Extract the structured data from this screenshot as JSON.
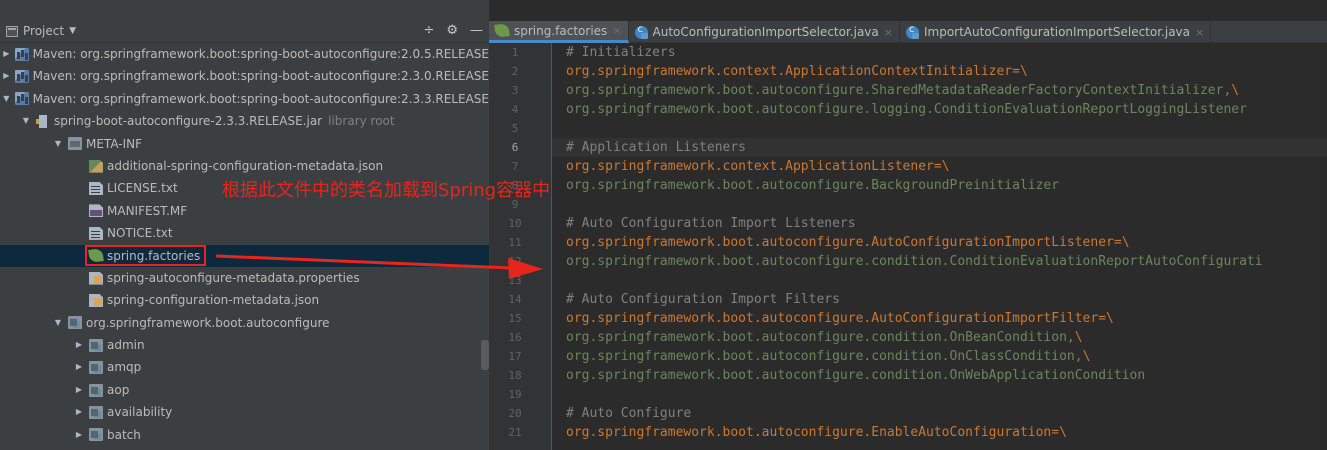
{
  "project": {
    "title": "Project",
    "tools": [
      "÷",
      "⚙",
      "—"
    ],
    "tree": [
      {
        "level": 0,
        "toggle": "collapsed",
        "icon": "maven-library-icon",
        "label": "Maven: org.springframework.boot:spring-boot-autoconfigure:2.0.5.RELEASE"
      },
      {
        "level": 0,
        "toggle": "collapsed",
        "icon": "maven-library-icon",
        "label": "Maven: org.springframework.boot:spring-boot-autoconfigure:2.3.0.RELEASE"
      },
      {
        "level": 0,
        "toggle": "expanded",
        "icon": "maven-library-icon",
        "label": "Maven: org.springframework.boot:spring-boot-autoconfigure:2.3.3.RELEASE"
      },
      {
        "level": 1,
        "toggle": "expanded",
        "icon": "jar-icon",
        "label": "spring-boot-autoconfigure-2.3.3.RELEASE.jar",
        "suffix": "library root"
      },
      {
        "level": 2,
        "toggle": "expanded",
        "icon": "folder-icon",
        "label": "META-INF"
      },
      {
        "level": 3,
        "toggle": "none",
        "icon": "json-icon",
        "label": "additional-spring-configuration-metadata.json"
      },
      {
        "level": 3,
        "toggle": "none",
        "icon": "text-file-icon",
        "label": "LICENSE.txt"
      },
      {
        "level": 3,
        "toggle": "none",
        "icon": "manifest-icon",
        "label": "MANIFEST.MF"
      },
      {
        "level": 3,
        "toggle": "none",
        "icon": "text-file-icon",
        "label": "NOTICE.txt"
      },
      {
        "level": 3,
        "toggle": "none",
        "icon": "spring-icon",
        "label": "spring.factories",
        "selected": true
      },
      {
        "level": 3,
        "toggle": "none",
        "icon": "properties-icon",
        "label": "spring-autoconfigure-metadata.properties"
      },
      {
        "level": 3,
        "toggle": "none",
        "icon": "json-config-icon",
        "label": "spring-configuration-metadata.json"
      },
      {
        "level": 2,
        "toggle": "expanded",
        "icon": "package-icon",
        "label": "org.springframework.boot.autoconfigure"
      },
      {
        "level": 3,
        "toggle": "collapsed",
        "icon": "package-icon",
        "label": "admin"
      },
      {
        "level": 3,
        "toggle": "collapsed",
        "icon": "package-icon",
        "label": "amqp"
      },
      {
        "level": 3,
        "toggle": "collapsed",
        "icon": "package-icon",
        "label": "aop"
      },
      {
        "level": 3,
        "toggle": "collapsed",
        "icon": "package-icon",
        "label": "availability"
      },
      {
        "level": 3,
        "toggle": "collapsed",
        "icon": "package-icon",
        "label": "batch"
      }
    ]
  },
  "editor": {
    "tabs": [
      {
        "label": "spring.factories",
        "icon": "spring-icon",
        "active": true
      },
      {
        "label": "AutoConfigurationImportSelector.java",
        "icon": "class-icon",
        "active": false
      },
      {
        "label": "ImportAutoConfigurationImportSelector.java",
        "icon": "class-icon",
        "active": false
      }
    ],
    "current_line": 6,
    "lines": [
      {
        "n": "1",
        "type": "comment",
        "text": "# Initializers"
      },
      {
        "n": "2",
        "type": "key",
        "text": "org.springframework.context.ApplicationContextInitializer",
        "op": "=\\"
      },
      {
        "n": "3",
        "type": "value",
        "text": "org.springframework.boot.autoconfigure.SharedMetadataReaderFactoryContextInitializer,",
        "op": "\\"
      },
      {
        "n": "4",
        "type": "value",
        "text": "org.springframework.boot.autoconfigure.logging.ConditionEvaluationReportLoggingListener",
        "op": ""
      },
      {
        "n": "5",
        "type": "blank",
        "text": ""
      },
      {
        "n": "6",
        "type": "comment",
        "text": "# Application Listeners"
      },
      {
        "n": "7",
        "type": "key",
        "text": "org.springframework.context.ApplicationListener",
        "op": "=\\"
      },
      {
        "n": "8",
        "type": "value",
        "text": "org.springframework.boot.autoconfigure.BackgroundPreinitializer",
        "op": ""
      },
      {
        "n": "9",
        "type": "blank",
        "text": ""
      },
      {
        "n": "10",
        "type": "comment",
        "text": "# Auto Configuration Import Listeners"
      },
      {
        "n": "11",
        "type": "key",
        "text": "org.springframework.boot.autoconfigure.AutoConfigurationImportListener",
        "op": "=\\"
      },
      {
        "n": "12",
        "type": "value",
        "text": "org.springframework.boot.autoconfigure.condition.ConditionEvaluationReportAutoConfigurati",
        "op": ""
      },
      {
        "n": "13",
        "type": "blank",
        "text": ""
      },
      {
        "n": "14",
        "type": "comment",
        "text": "# Auto Configuration Import Filters"
      },
      {
        "n": "15",
        "type": "key",
        "text": "org.springframework.boot.autoconfigure.AutoConfigurationImportFilter",
        "op": "=\\"
      },
      {
        "n": "16",
        "type": "value",
        "text": "org.springframework.boot.autoconfigure.condition.OnBeanCondition,",
        "op": "\\"
      },
      {
        "n": "17",
        "type": "value",
        "text": "org.springframework.boot.autoconfigure.condition.OnClassCondition,",
        "op": "\\"
      },
      {
        "n": "18",
        "type": "value",
        "text": "org.springframework.boot.autoconfigure.condition.OnWebApplicationCondition",
        "op": ""
      },
      {
        "n": "19",
        "type": "blank",
        "text": ""
      },
      {
        "n": "20",
        "type": "comment",
        "text": "# Auto Configure"
      },
      {
        "n": "21",
        "type": "key",
        "text": "org.springframework.boot.autoconfigure.EnableAutoConfiguration",
        "op": "=\\"
      }
    ]
  },
  "annotation": {
    "text": "根据此文件中的类名加载到Spring容器中",
    "color": "#e8251b"
  }
}
